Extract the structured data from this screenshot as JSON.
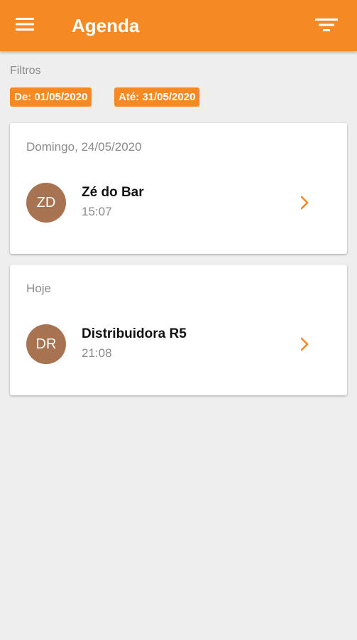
{
  "app": {
    "title": "Agenda"
  },
  "header": {
    "menu_icon": "menu-icon",
    "filter_icon": "filter-icon"
  },
  "filters": {
    "label": "Filtros",
    "from": "De: 01/05/2020",
    "to": "Até: 31/05/2020"
  },
  "groups": [
    {
      "date": "Domingo, 24/05/2020",
      "items": [
        {
          "initials": "ZD",
          "name": "Zé do Bar",
          "time": "15:07"
        }
      ]
    },
    {
      "date": "Hoje",
      "items": [
        {
          "initials": "DR",
          "name": "Distribuidora R5",
          "time": "21:08"
        }
      ]
    }
  ],
  "colors": {
    "accent": "#f58a25",
    "avatar": "#a87350",
    "background": "#eeeeee",
    "muted_text": "#8a8a8a"
  }
}
